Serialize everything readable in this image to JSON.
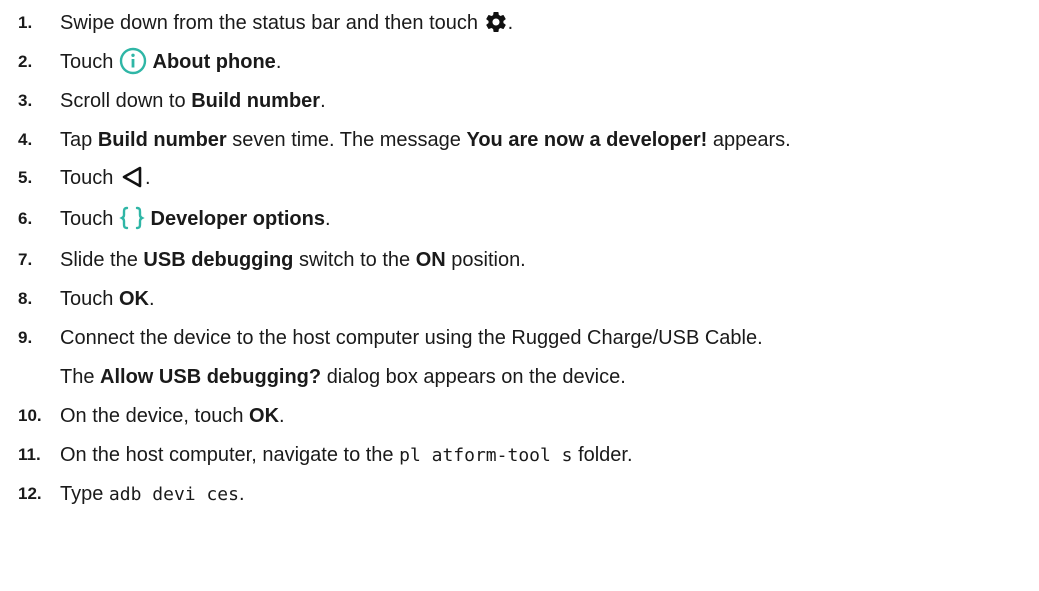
{
  "steps": [
    {
      "num": "1.",
      "parts": [
        "Swipe down from the status bar and then touch",
        "."
      ],
      "icon": "gear-icon"
    },
    {
      "num": "2.",
      "parts": [
        "Touch",
        "About phone",
        "."
      ],
      "icon": "info-icon",
      "icon_color": "#2fb6a6"
    },
    {
      "num": "3.",
      "parts": [
        "Scroll down to",
        "Build number",
        "."
      ]
    },
    {
      "num": "4.",
      "parts": [
        "Tap",
        "Build number",
        "seven time. The message",
        "You are now a developer!",
        "appears."
      ]
    },
    {
      "num": "5.",
      "parts": [
        "Touch",
        "."
      ],
      "icon": "back-triangle-icon"
    },
    {
      "num": "6.",
      "parts": [
        "Touch",
        "Developer options",
        "."
      ],
      "icon": "braces-icon",
      "icon_color": "#2fb6a6"
    },
    {
      "num": "7.",
      "parts": [
        "Slide the",
        "USB debugging",
        "switch to the",
        "ON",
        "position."
      ]
    },
    {
      "num": "8.",
      "parts": [
        "Touch",
        "OK",
        "."
      ]
    },
    {
      "num": "9.",
      "parts": [
        "Connect the device to the host computer using the Rugged Charge/USB Cable."
      ]
    },
    {
      "num": "",
      "parts": [
        "The",
        "Allow USB debugging?",
        "dialog box appears on the device."
      ]
    },
    {
      "num": "10.",
      "parts": [
        "On the device, touch",
        "OK",
        "."
      ]
    },
    {
      "num": "11.",
      "parts": [
        "On the host computer, navigate to the",
        "pl atform-tool s",
        "folder."
      ]
    },
    {
      "num": "12.",
      "parts": [
        "Type",
        "adb devi ces",
        "."
      ]
    }
  ]
}
